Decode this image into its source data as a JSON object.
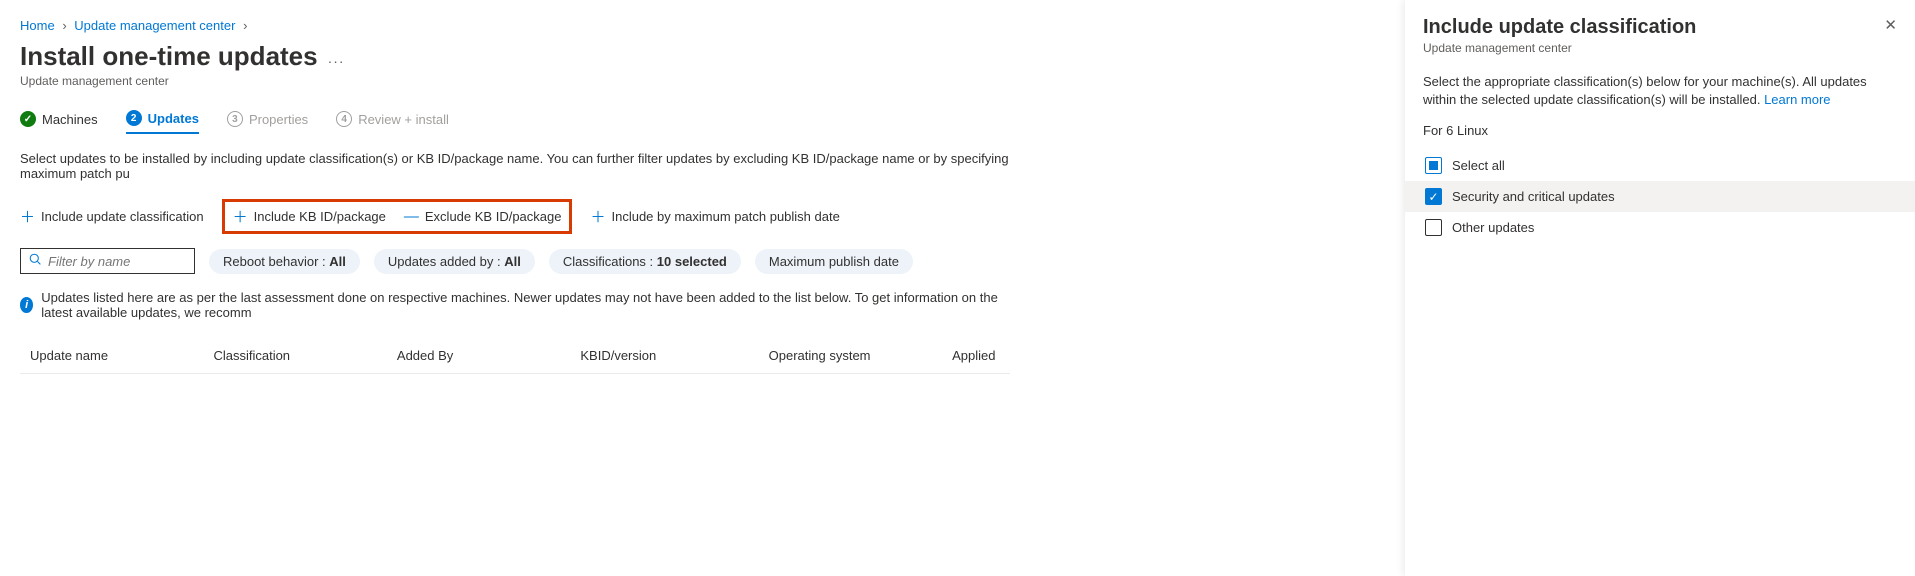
{
  "breadcrumb": {
    "home": "Home",
    "parent": "Update management center"
  },
  "page": {
    "title": "Install one-time updates",
    "subtitle": "Update management center"
  },
  "tabs": {
    "machines": {
      "label": "Machines"
    },
    "updates": {
      "label": "Updates",
      "num": "2"
    },
    "properties": {
      "label": "Properties",
      "num": "3"
    },
    "review": {
      "label": "Review + install",
      "num": "4"
    }
  },
  "intro": "Select updates to be installed by including update classification(s) or KB ID/package name. You can further filter updates by excluding KB ID/package name or by specifying maximum patch pu",
  "actions": {
    "include_classification": "Include update classification",
    "include_kb": "Include KB ID/package",
    "exclude_kb": "Exclude KB ID/package",
    "include_date": "Include by maximum patch publish date"
  },
  "search": {
    "placeholder": "Filter by name"
  },
  "pills": {
    "reboot": {
      "label": "Reboot behavior : ",
      "value": "All"
    },
    "added": {
      "label": "Updates added by : ",
      "value": "All"
    },
    "classifications": {
      "label": "Classifications : ",
      "value": "10 selected"
    },
    "maxdate": {
      "label": "Maximum publish date"
    }
  },
  "info_banner": "Updates listed here are as per the last assessment done on respective machines. Newer updates may not have been added to the list below. To get information on the latest available updates, we recomm",
  "columns": {
    "name": "Update name",
    "classification": "Classification",
    "added_by": "Added By",
    "kbid": "KBID/version",
    "os": "Operating system",
    "applied": "Applied"
  },
  "panel": {
    "title": "Include update classification",
    "subtitle": "Update management center",
    "desc": "Select the appropriate classification(s) below for your machine(s). All updates within the selected update classification(s) will be installed. ",
    "learn_more": "Learn more",
    "for_label": "For 6 Linux",
    "select_all": "Select all",
    "security": "Security and critical updates",
    "other": "Other updates"
  }
}
